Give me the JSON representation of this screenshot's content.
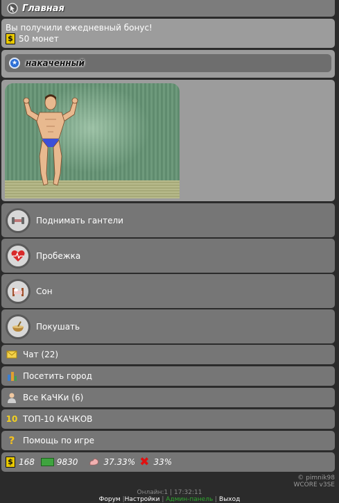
{
  "header": {
    "title": "Главная",
    "icon": "cursor-icon"
  },
  "bonus": {
    "line1": "Вы получили ежедневный бонус!",
    "coin_symbol": "$",
    "amount": "50 монет"
  },
  "rank": {
    "label": "накаченный",
    "badge_icon": "star-badge-icon",
    "badge_color": "#2d6fd6"
  },
  "actions": [
    {
      "label": "Поднимать гантели",
      "icon": "dumbbell-icon"
    },
    {
      "label": "Пробежка",
      "icon": "heart-rate-icon"
    },
    {
      "label": "Сон",
      "icon": "bed-icon"
    },
    {
      "label": "Покушать",
      "icon": "food-bowl-icon"
    }
  ],
  "menu": [
    {
      "label": "Чат (22)",
      "icon": "envelope-icon"
    },
    {
      "label": "Посетить город",
      "icon": "city-icon"
    },
    {
      "label": "Все КаЧКи (6)",
      "icon": "person-icon"
    },
    {
      "label": "ТОП-10 КАЧКОВ",
      "icon": "top10-icon"
    },
    {
      "label": "Помощь по игре",
      "icon": "question-icon"
    }
  ],
  "stats": {
    "coins_symbol": "$",
    "coins": "168",
    "money": "9830",
    "muscle": "37.33%",
    "fatigue": "33%"
  },
  "footer": {
    "copyright": "© pimnik98",
    "engine": "WCORE v3SE",
    "online": "Онлайн:1 | 17:32:11",
    "links": [
      "Форум",
      "Настройки",
      "Админ-панель",
      "Выход"
    ]
  }
}
